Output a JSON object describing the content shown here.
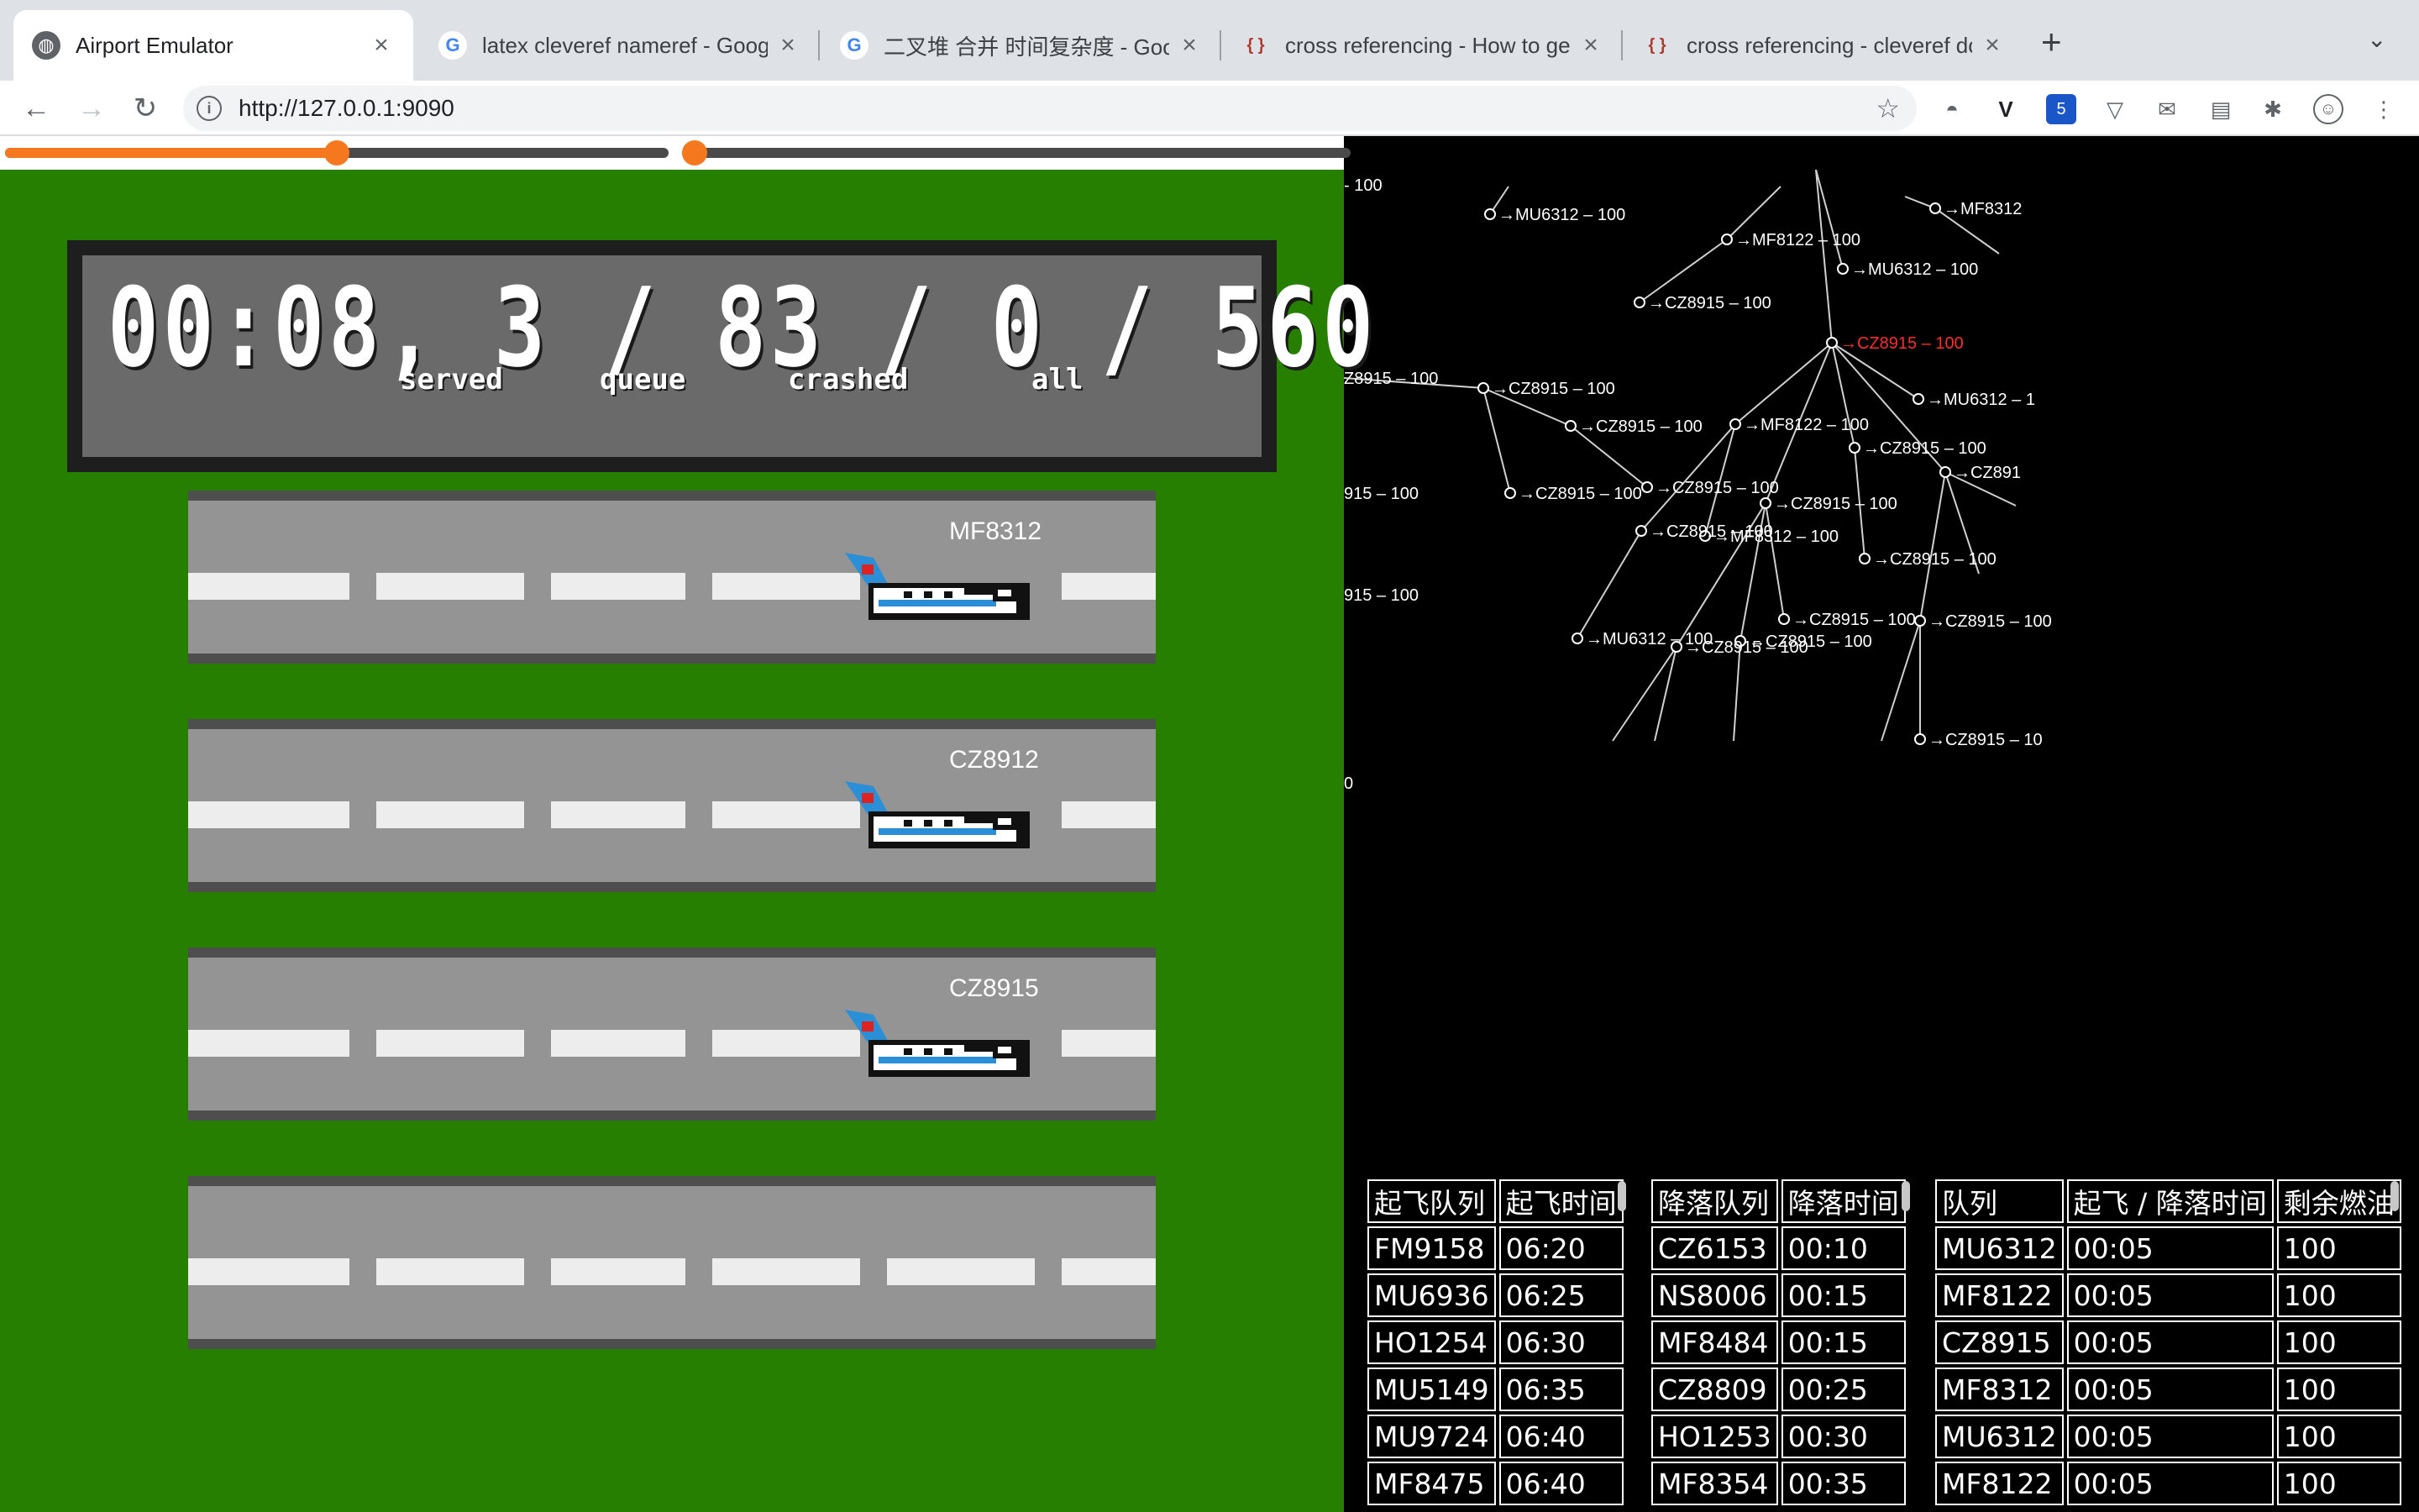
{
  "browser": {
    "tabs": [
      {
        "title": "Airport Emulator",
        "active": true
      },
      {
        "title": "latex cleveref nameref - Google",
        "active": false
      },
      {
        "title": "二叉堆 合并 时间复杂度 - Google",
        "active": false
      },
      {
        "title": "cross referencing - How to get",
        "active": false
      },
      {
        "title": "cross referencing - cleveref do",
        "active": false
      }
    ],
    "url": "http://127.0.0.1:9090",
    "extension_badge": "5"
  },
  "sliders": [
    {
      "value": 0.5
    },
    {
      "value": 0.0
    }
  ],
  "scoreboard": {
    "time": "00:08,",
    "served": "3",
    "queue": "83",
    "crashed": "0",
    "all": "560",
    "sep": "/",
    "labels": {
      "served": "served",
      "queue": "queue",
      "crashed": "crashed",
      "all": "all"
    }
  },
  "runways": [
    {
      "flight": "MF8312"
    },
    {
      "flight": "CZ8912"
    },
    {
      "flight": "CZ8915"
    },
    {
      "flight": ""
    }
  ],
  "tree": {
    "nodes": [
      {
        "label": "→MU6312 – 100"
      },
      {
        "label": "→MF8122 – 100"
      },
      {
        "label": "→MU6312 – 100"
      },
      {
        "label": "→MF8312"
      },
      {
        "label": "→CZ8915 – 100"
      },
      {
        "label": "→CZ8915 – 100"
      },
      {
        "label": "→CZ8915 – 100"
      },
      {
        "label": "→MU6312 – 1"
      },
      {
        "label": "→CZ8915 – 100"
      },
      {
        "label": "→MF8122 – 100"
      },
      {
        "label": "→CZ8915 – 100"
      },
      {
        "label": "→CZ891"
      },
      {
        "label": "→CZ8915 – 100"
      },
      {
        "label": "→CZ8915 – 100"
      },
      {
        "label": "→CZ8915 – 100"
      },
      {
        "label": "→CZ8915 – 100"
      },
      {
        "label": "→MF8312 – 100"
      },
      {
        "label": "→CZ8915 – 100"
      },
      {
        "label": "→CZ8915 – 100"
      },
      {
        "label": "→MU6312 – 100"
      },
      {
        "label": "→CZ8915 – 100"
      },
      {
        "label": "→CZ8915 – 100"
      },
      {
        "label": "→CZ8915 – 100"
      },
      {
        "label": "→CZ8915 – 10"
      }
    ],
    "edge_labels": [
      "- 100",
      "Z8915 – 100",
      "915 – 100",
      "915 – 100",
      "0"
    ]
  },
  "takeoff_table": {
    "headers": [
      "起飞队列",
      "起飞时间"
    ],
    "rows": [
      [
        "FM9158",
        "06:20"
      ],
      [
        "MU6936",
        "06:25"
      ],
      [
        "HO1254",
        "06:30"
      ],
      [
        "MU5149",
        "06:35"
      ],
      [
        "MU9724",
        "06:40"
      ],
      [
        "MF8475",
        "06:40"
      ]
    ]
  },
  "landing_table": {
    "headers": [
      "降落队列",
      "降落时间"
    ],
    "rows": [
      [
        "CZ6153",
        "00:10"
      ],
      [
        "NS8006",
        "00:15"
      ],
      [
        "MF8484",
        "00:15"
      ],
      [
        "CZ8809",
        "00:25"
      ],
      [
        "HO1253",
        "00:30"
      ],
      [
        "MF8354",
        "00:35"
      ]
    ]
  },
  "queue_table": {
    "headers": [
      "队列",
      "起飞 / 降落时间",
      "剩余燃油"
    ],
    "rows": [
      [
        "MU6312",
        "00:05",
        "100"
      ],
      [
        "MF8122",
        "00:05",
        "100"
      ],
      [
        "CZ8915",
        "00:05",
        "100"
      ],
      [
        "MF8312",
        "00:05",
        "100"
      ],
      [
        "MU6312",
        "00:05",
        "100"
      ],
      [
        "MF8122",
        "00:05",
        "100"
      ]
    ]
  },
  "colors": {
    "grass": "#267f00",
    "runway": "#949494",
    "slider": "#f5781f",
    "selected_node": "#ff2d2d"
  }
}
